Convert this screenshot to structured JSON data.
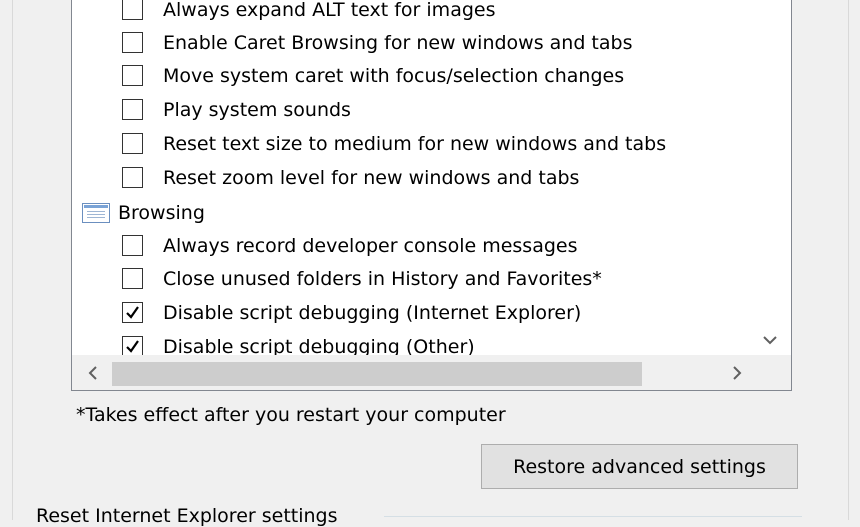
{
  "settings_tree": {
    "items_top": [
      {
        "label": "Always expand ALT text for images",
        "checked": false
      },
      {
        "label": "Enable Caret Browsing for new windows and tabs",
        "checked": false
      },
      {
        "label": "Move system caret with focus/selection changes",
        "checked": false
      },
      {
        "label": "Play system sounds",
        "checked": false
      },
      {
        "label": "Reset text size to medium for new windows and tabs",
        "checked": false
      },
      {
        "label": "Reset zoom level for new windows and tabs",
        "checked": false
      }
    ],
    "category_browsing": {
      "label": "Browsing",
      "icon": "settings-category-icon"
    },
    "items_browsing": [
      {
        "label": "Always record developer console messages",
        "checked": false
      },
      {
        "label": "Close unused folders in History and Favorites*",
        "checked": false
      },
      {
        "label": "Disable script debugging (Internet Explorer)",
        "checked": true
      },
      {
        "label": "Disable script debugging (Other)",
        "checked": true
      }
    ]
  },
  "note": "*Takes effect after you restart your computer",
  "restore_button_label": "Restore advanced settings",
  "reset_group_title": "Reset Internet Explorer settings"
}
